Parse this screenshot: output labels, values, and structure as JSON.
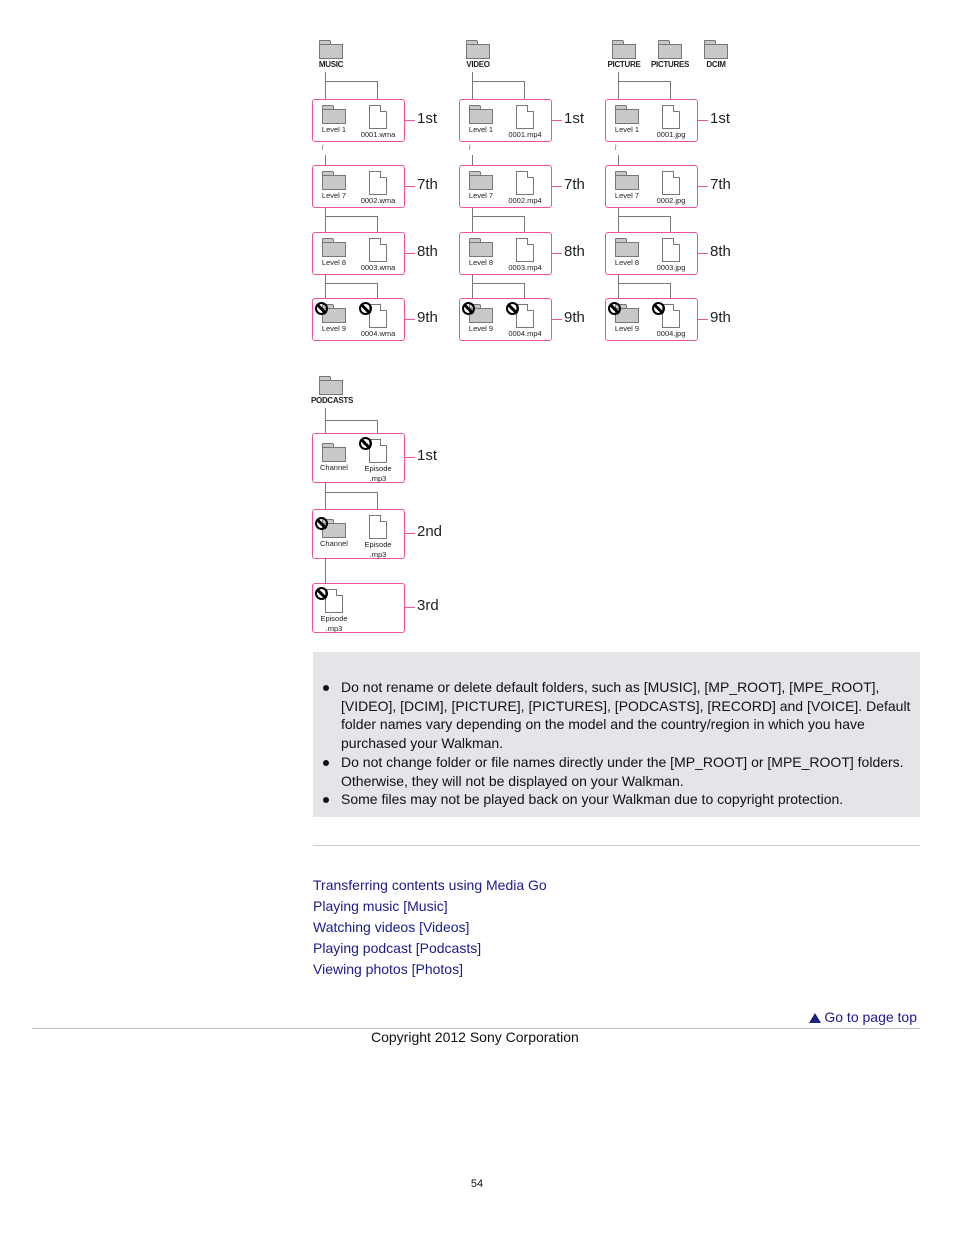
{
  "diagram": {
    "columns": [
      {
        "roots": [
          "MUSIC"
        ],
        "levels": [
          {
            "tag": "1st",
            "folder": "Level 1",
            "file": "0001.wma",
            "folder_blocked": false,
            "file_blocked": false
          },
          {
            "tag": "7th",
            "folder": "Level 7",
            "file": "0002.wma",
            "folder_blocked": false,
            "file_blocked": false
          },
          {
            "tag": "8th",
            "folder": "Level 8",
            "file": "0003.wma",
            "folder_blocked": false,
            "file_blocked": false
          },
          {
            "tag": "9th",
            "folder": "Level 9",
            "file": "0004.wma",
            "folder_blocked": true,
            "file_blocked": true
          }
        ]
      },
      {
        "roots": [
          "VIDEO"
        ],
        "levels": [
          {
            "tag": "1st",
            "folder": "Level 1",
            "file": "0001.mp4",
            "folder_blocked": false,
            "file_blocked": false
          },
          {
            "tag": "7th",
            "folder": "Level 7",
            "file": "0002.mp4",
            "folder_blocked": false,
            "file_blocked": false
          },
          {
            "tag": "8th",
            "folder": "Level 8",
            "file": "0003.mp4",
            "folder_blocked": false,
            "file_blocked": false
          },
          {
            "tag": "9th",
            "folder": "Level 9",
            "file": "0004.mp4",
            "folder_blocked": true,
            "file_blocked": true
          }
        ]
      },
      {
        "roots": [
          "PICTURE",
          "PICTURES",
          "DCIM"
        ],
        "levels": [
          {
            "tag": "1st",
            "folder": "Level 1",
            "file": "0001.jpg",
            "folder_blocked": false,
            "file_blocked": false
          },
          {
            "tag": "7th",
            "folder": "Level 7",
            "file": "0002.jpg",
            "folder_blocked": false,
            "file_blocked": false
          },
          {
            "tag": "8th",
            "folder": "Level 8",
            "file": "0003.jpg",
            "folder_blocked": false,
            "file_blocked": false
          },
          {
            "tag": "9th",
            "folder": "Level 9",
            "file": "0004.jpg",
            "folder_blocked": true,
            "file_blocked": true
          }
        ]
      }
    ],
    "podcasts": {
      "root": "PODCASTS",
      "levels": [
        {
          "tag": "1st",
          "folder": "Channel",
          "file_line1": "Episode",
          "file_line2": ".mp3",
          "folder_blocked": false,
          "file_blocked": true
        },
        {
          "tag": "2nd",
          "folder": "Channel",
          "file_line1": "Episode",
          "file_line2": ".mp3",
          "folder_blocked": true,
          "file_blocked": false
        },
        {
          "tag": "3rd",
          "file_line1": "Episode",
          "file_line2": ".mp3",
          "file_blocked": true
        }
      ]
    }
  },
  "note": {
    "items": [
      "Do not rename or delete default folders, such as [MUSIC], [MP_ROOT], [MPE_ROOT], [VIDEO], [DCIM], [PICTURE], [PICTURES], [PODCASTS], [RECORD] and [VOICE]. Default folder names vary depending on the model and the country/region in which you have purchased your Walkman.",
      "Do not change folder or file names directly under the [MP_ROOT] or [MPE_ROOT] folders. Otherwise, they will not be displayed on your Walkman.",
      "Some files may not be played back on your Walkman due to copyright protection."
    ]
  },
  "related_links": [
    "Transferring contents using Media Go",
    "Playing music [Music]",
    "Watching videos [Videos]",
    "Playing podcast [Podcasts]",
    "Viewing photos [Photos]"
  ],
  "page_top": {
    "label": "Go to page top",
    "icon": "triangle-up-icon"
  },
  "footer": {
    "copyright": "Copyright 2012 Sony Corporation",
    "page_number": "54"
  },
  "colors": {
    "level_box_border": "#e9559d",
    "link": "#1a1a8c",
    "note_bg": "#e3e5e8"
  }
}
